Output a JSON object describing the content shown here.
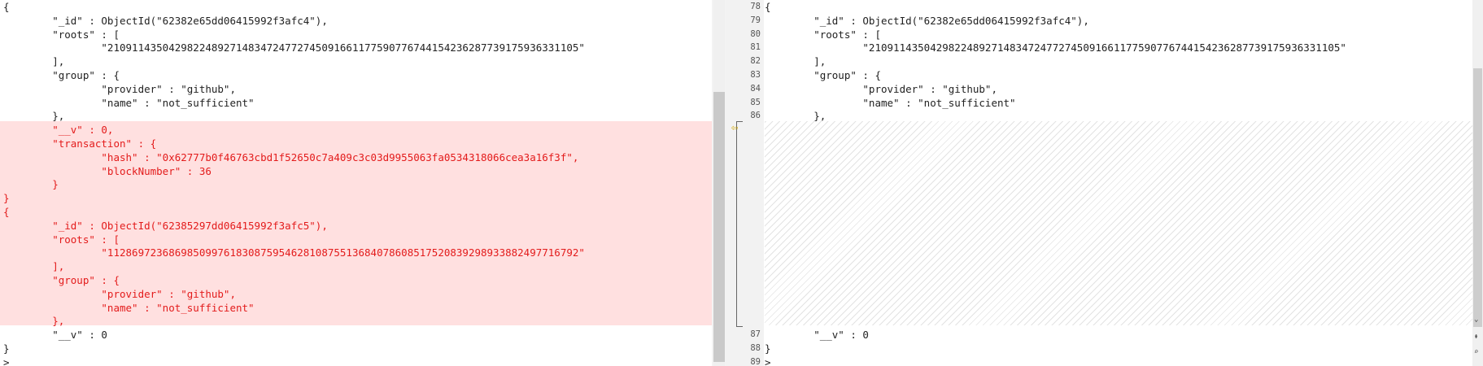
{
  "left": {
    "normal_top": [
      "{",
      "        \"_id\" : ObjectId(\"62382e65dd06415992f3afc4\"),",
      "        \"roots\" : [",
      "                \"21091143504298224892714834724772745091661177590776744154236287739175936331105\"",
      "        ],",
      "        \"group\" : {",
      "                \"provider\" : \"github\",",
      "                \"name\" : \"not_sufficient\"",
      "        },"
    ],
    "deleted": [
      "        \"__v\" : 0,",
      "        \"transaction\" : {",
      "                \"hash\" : \"0x62777b0f46763cbd1f52650c7a409c3c03d9955063fa0534318066cea3a16f3f\",",
      "                \"blockNumber\" : 36",
      "        }",
      "}",
      "{",
      "        \"_id\" : ObjectId(\"62385297dd06415992f3afc5\"),",
      "        \"roots\" : [",
      "                \"11286972368698509976183087595462810875513684078608517520839298933882497716792\"",
      "        ],",
      "        \"group\" : {",
      "                \"provider\" : \"github\",",
      "                \"name\" : \"not_sufficient\"",
      "        },"
    ],
    "normal_bottom": [
      "        \"__v\" : 0",
      "}",
      ">"
    ]
  },
  "right": {
    "top_lines": [
      {
        "n": "78",
        "t": "{"
      },
      {
        "n": "79",
        "t": "        \"_id\" : ObjectId(\"62382e65dd06415992f3afc4\"),"
      },
      {
        "n": "80",
        "t": "        \"roots\" : ["
      },
      {
        "n": "81",
        "t": "                \"21091143504298224892714834724772745091661177590776744154236287739175936331105\""
      },
      {
        "n": "82",
        "t": "        ],"
      },
      {
        "n": "83",
        "t": "        \"group\" : {"
      },
      {
        "n": "84",
        "t": "                \"provider\" : \"github\","
      },
      {
        "n": "85",
        "t": "                \"name\" : \"not_sufficient\""
      },
      {
        "n": "86",
        "t": "        },"
      }
    ],
    "bottom_lines": [
      {
        "n": "87",
        "t": "        \"__v\" : 0"
      },
      {
        "n": "88",
        "t": "}"
      },
      {
        "n": "89",
        "t": ">"
      }
    ]
  },
  "icons": {
    "merge_arrow": "arrow-left-icon",
    "scroll_down": "chevron-down-icon",
    "scroll_top": "scroll-to-top-icon",
    "find": "magnifier-icon"
  },
  "colors": {
    "deleted_text": "#e31b1b",
    "deleted_background": "#ffe0e0",
    "merge_arrow": "#d4a900"
  }
}
